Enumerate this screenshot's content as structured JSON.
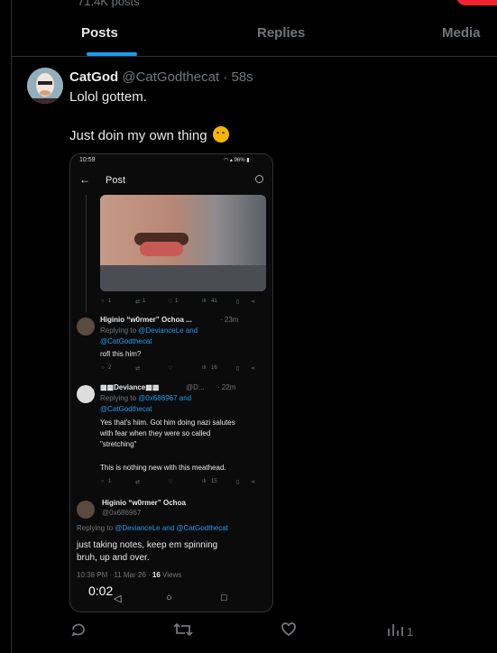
{
  "profile": {
    "post_count": "71.4K posts"
  },
  "tabs": [
    {
      "label": "Posts"
    },
    {
      "label": "Replies"
    },
    {
      "label": "Media"
    }
  ],
  "post": {
    "display_name": "CatGod",
    "handle": "@CatGodthecat",
    "time": "· 58s",
    "line1": "Lolol gottem.",
    "line2": "Just doin my own thing",
    "actions": {
      "views": "1"
    }
  },
  "embedded": {
    "status_time": "10:59",
    "status_right": "96%",
    "page_title": "Post",
    "media_actions": {
      "replies": "1",
      "reposts": "1",
      "likes": "1",
      "views": "41"
    },
    "reply1": {
      "name": "Higinio “w0rmer” Ochoa ...",
      "time": "· 23m",
      "replying_prefix": "Replying to ",
      "replying_users": "@DevianceLe and",
      "replying_user2": "@CatGodthecat",
      "text": "rofl this him?",
      "actions": {
        "replies": "2",
        "views": "16"
      }
    },
    "reply2": {
      "name": "Deviance",
      "handle": "@D...",
      "time": "· 22m",
      "replying_prefix": "Replying to ",
      "replying_users": "@0x686967 and",
      "replying_user2": "@CatGodthecat",
      "text_lines": [
        "Yes that's hiim. Got him doing nazi salutes",
        "with fear when they were so called",
        "\"stretching\"",
        "",
        "This is nothing new with this meathead."
      ],
      "actions": {
        "replies": "1",
        "views": "15"
      }
    },
    "main": {
      "name": "Higinio “w0rmer” Ochoa",
      "handle": "@0x686967",
      "replying_prefix": "Replying to ",
      "replying_users": "@DevianceLe and @CatGodthecat",
      "text_lines": [
        "just taking notes, keep em spinning",
        "bruh, up and over."
      ],
      "footer_time": "10:38 PM · 11 Mar 26 · ",
      "footer_views_count": "16",
      "footer_views_label": " Views"
    },
    "video_timer": "0:02"
  },
  "colors": {
    "accent": "#1d9bf0",
    "muted": "#71767b",
    "text": "#e7e9ea",
    "background": "#000000"
  }
}
